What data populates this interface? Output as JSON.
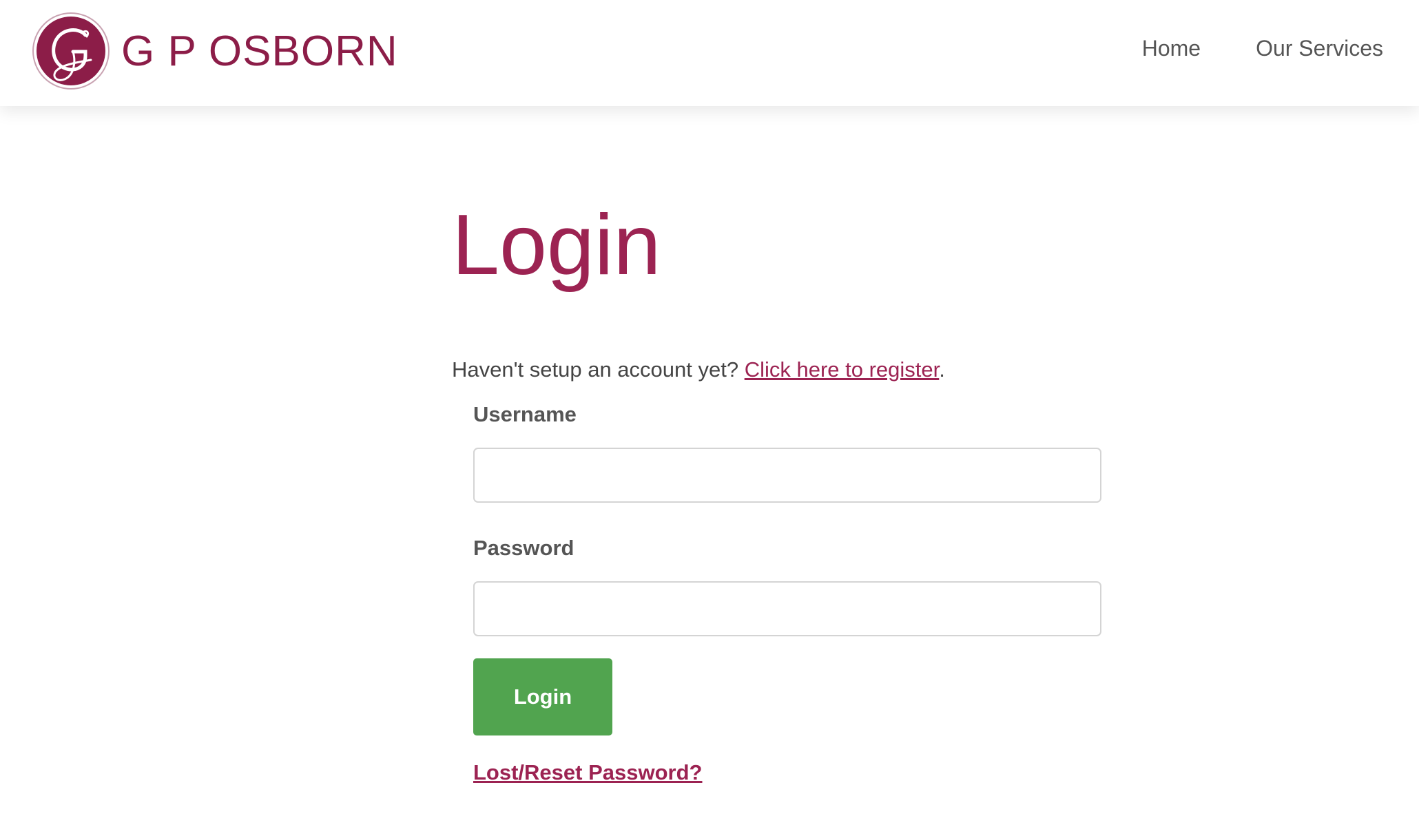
{
  "header": {
    "brand": "G P OSBORN",
    "logo_icon": "g-monogram-logo",
    "nav": {
      "home": "Home",
      "services": "Our Services"
    }
  },
  "main": {
    "title": "Login",
    "register_prompt": "Haven't setup an account yet? ",
    "register_link": "Click here to register",
    "register_suffix": ".",
    "username_label": "Username",
    "username_value": "",
    "password_label": "Password",
    "password_value": "",
    "login_button": "Login",
    "lost_password_link": "Lost/Reset Password?"
  },
  "colors": {
    "brand": "#8c1d48",
    "link": "#9c2352",
    "button": "#51a44f"
  }
}
